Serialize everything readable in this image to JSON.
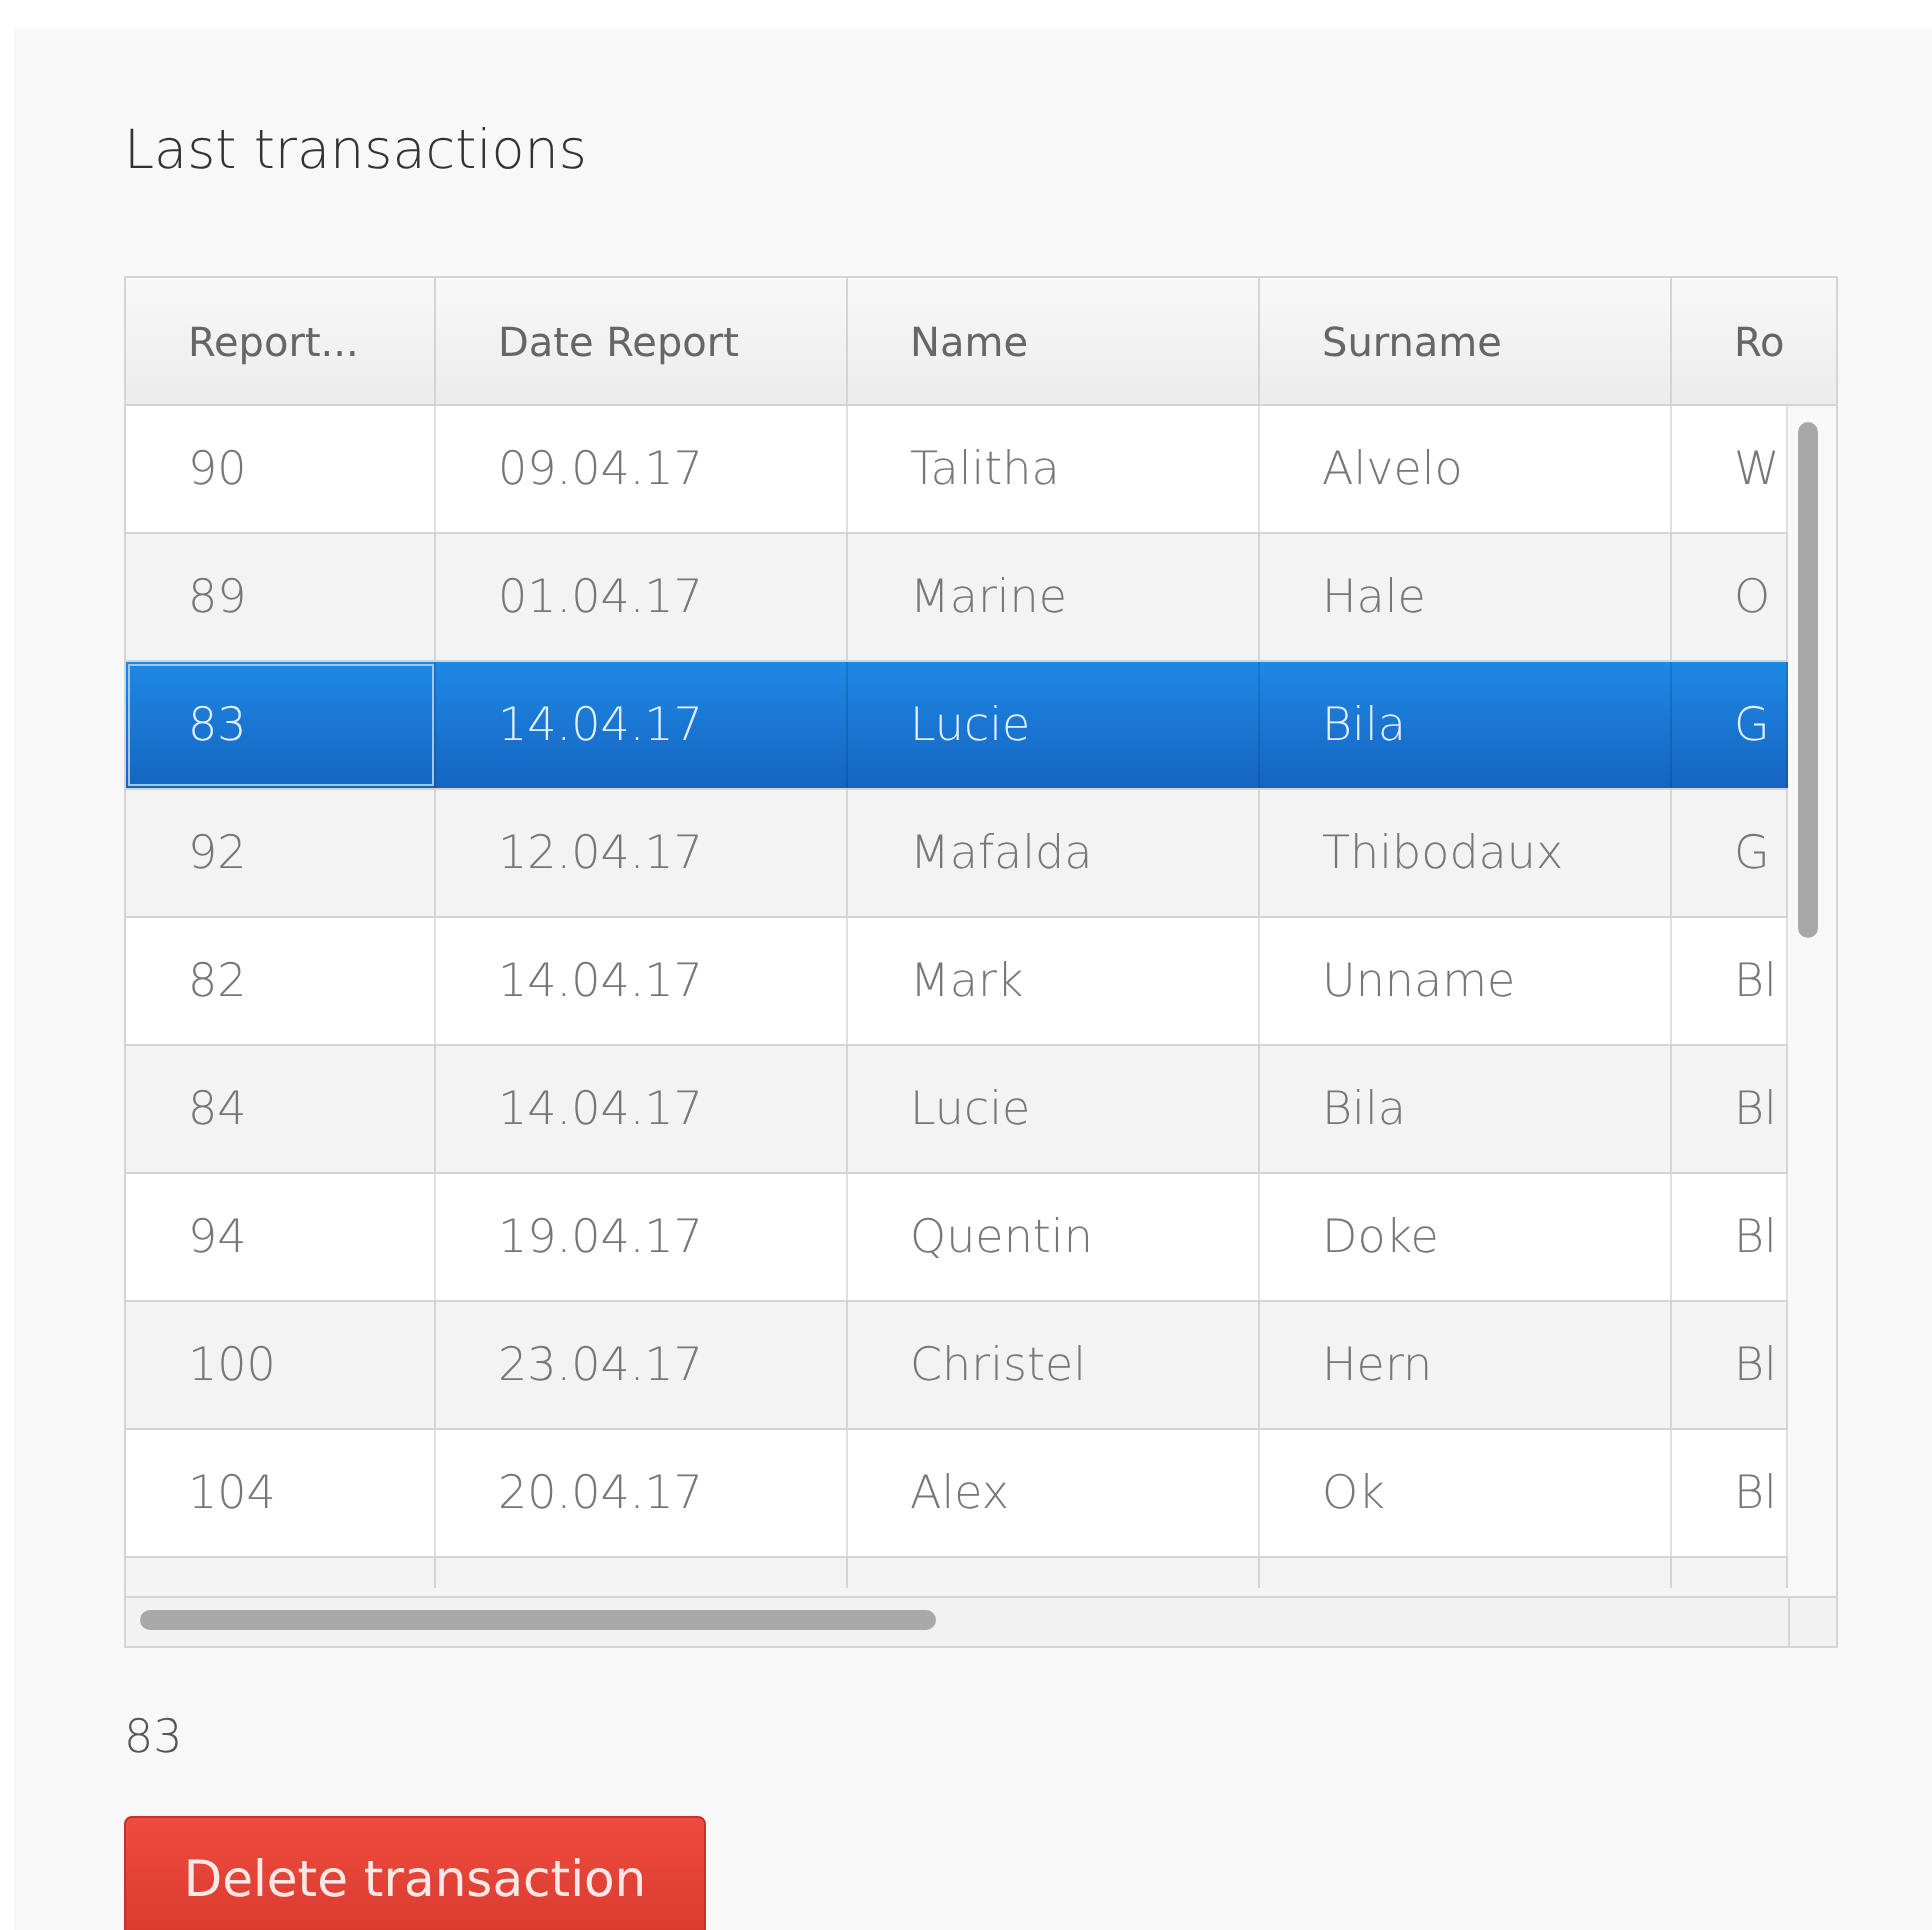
{
  "title": "Last transactions",
  "table": {
    "columns": [
      "Report...",
      "Date Report",
      "Name",
      "Surname",
      "Ro"
    ],
    "rows": [
      {
        "cells": [
          "90",
          "09.04.17",
          "Talitha",
          "Alvelo",
          "W"
        ],
        "selected": false
      },
      {
        "cells": [
          "89",
          "01.04.17",
          "Marine",
          "Hale",
          "O"
        ],
        "selected": false
      },
      {
        "cells": [
          "83",
          "14.04.17",
          "Lucie",
          "Bila",
          "G"
        ],
        "selected": true
      },
      {
        "cells": [
          "92",
          "12.04.17",
          "Mafalda",
          "Thibodaux",
          "G"
        ],
        "selected": false
      },
      {
        "cells": [
          "82",
          "14.04.17",
          "Mark",
          "Unname",
          "Bl"
        ],
        "selected": false
      },
      {
        "cells": [
          "84",
          "14.04.17",
          "Lucie",
          "Bila",
          "Bl"
        ],
        "selected": false
      },
      {
        "cells": [
          "94",
          "19.04.17",
          "Quentin",
          "Doke",
          "Bl"
        ],
        "selected": false
      },
      {
        "cells": [
          "100",
          "23.04.17",
          "Christel",
          "Hern",
          "Bl"
        ],
        "selected": false
      },
      {
        "cells": [
          "104",
          "20.04.17",
          "Alex",
          "Ok",
          "Bl"
        ],
        "selected": false
      }
    ]
  },
  "selected_value": "83",
  "button": "Delete transaction"
}
